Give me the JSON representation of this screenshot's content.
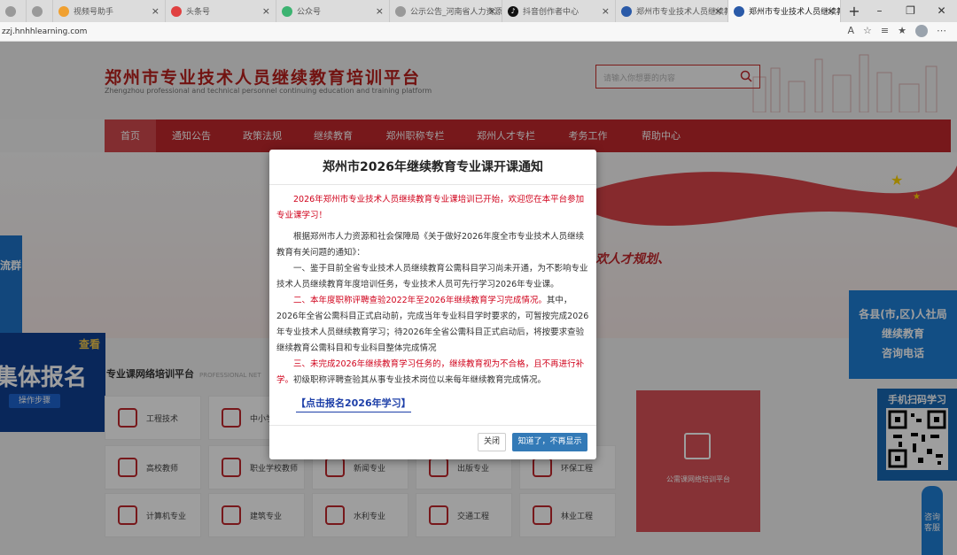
{
  "browser": {
    "tabs": [
      {
        "label": "",
        "color": "#888"
      },
      {
        "label": "",
        "color": "#888"
      },
      {
        "label": "视频号助手",
        "color": "#f0a030"
      },
      {
        "label": "头条号",
        "color": "#e04040"
      },
      {
        "label": "公众号",
        "color": "#3cb371"
      },
      {
        "label": "公示公告_河南省人力资源和",
        "color": "#888"
      },
      {
        "label": "抖音创作者中心",
        "color": "#111"
      },
      {
        "label": "郑州市专业技术人员继续教育",
        "color": "#2a5aa8"
      },
      {
        "label": "郑州市专业技术人员继续教育",
        "color": "#2a5aa8"
      }
    ],
    "url": "zzj.hnhhlearning.com"
  },
  "header": {
    "title": "郑州市专业技术人员继续教育培训平台",
    "subtitle": "Zhengzhou professional and technical personnel continuing education and training platform",
    "search_placeholder": "请输入你想要的内容"
  },
  "nav": [
    "首页",
    "通知公告",
    "政策法规",
    "继续教育",
    "郑州职称专栏",
    "郑州人才专栏",
    "考务工作",
    "帮助中心"
  ],
  "banner": {
    "slogan": "欢人才规划、"
  },
  "left_ads": {
    "flow": "流群",
    "view": "查看",
    "jiti": "集体报名",
    "step": "操作步骤"
  },
  "section": {
    "title": "专业课网络培训平台",
    "en": "PROFESSIONAL NET"
  },
  "tiles": [
    "工程技术",
    "中小学",
    "高校教师",
    "职业学校教师",
    "新闻专业",
    "出版专业",
    "环保工程",
    "计算机专业",
    "建筑专业",
    "水利专业",
    "交通工程",
    "林业工程"
  ],
  "public_platform": "公需课网络培训平台",
  "right_ad": [
    "各县(市,区)人社局",
    "继续教育",
    "咨询电话"
  ],
  "qr_title": "手机扫码学习",
  "consult": "咨询客服",
  "modal": {
    "title": "郑州市2026年继续教育专业课开课通知",
    "intro": "2026年郑州市专业技术人员继续教育专业课培训已开始，欢迎您在本平台参加专业课学习！",
    "p1": "根据郑州市人力资源和社会保障局《关于做好2026年度全市专业技术人员继续教育有关问题的通知》：",
    "p2": "一、鉴于目前全省专业技术人员继续教育公需科目学习尚未开通，为不影响专业技术人员继续教育年度培训任务，专业技术人员可先行学习2026年专业课。",
    "p3_red": "二、本年度职称评聘查验2022年至2026年继续教育学习完成情况。",
    "p3_rest": "其中，2026年全省公需科目正式启动前，完成当年专业科目学时要求的，可暂按完成2026年专业技术人员继续教育学习；待2026年全省公需科目正式启动后，将按要求查验继续教育公需科目和专业科目整体完成情况",
    "p4_red": "三、未完成2026年继续教育学习任务的，继续教育视为不合格，且不再进行补学。",
    "p4_rest": "初级职称评聘查验其从事专业技术岗位以来每年继续教育完成情况。",
    "link": "【点击报名2026年学习】",
    "close": "关闭",
    "ok": "知道了，不再显示"
  }
}
